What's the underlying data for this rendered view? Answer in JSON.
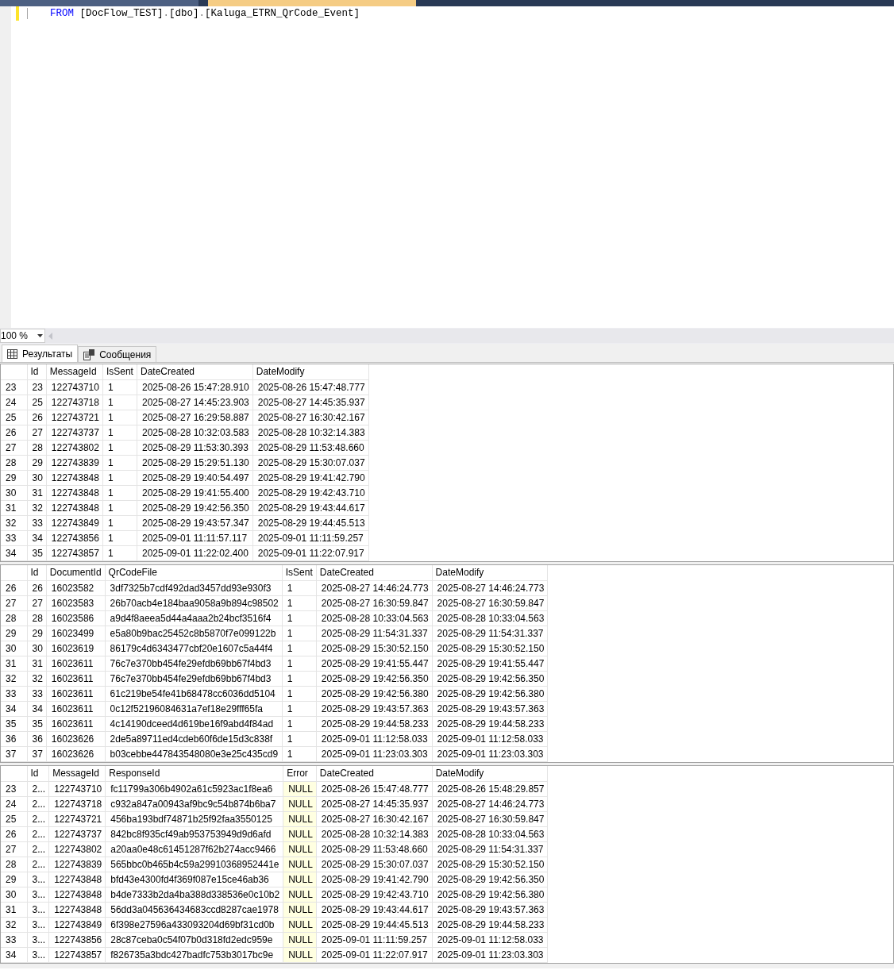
{
  "document_tabs": [
    {
      "selected": false
    },
    {
      "selected": true
    }
  ],
  "editor": {
    "lines": [
      [
        {
          "kind": "keyword",
          "text": "FROM"
        },
        {
          "kind": "plain",
          "text": " [DocFlow_TEST]"
        },
        {
          "kind": "punct",
          "text": "."
        },
        {
          "kind": "plain",
          "text": "[dbo]"
        },
        {
          "kind": "punct",
          "text": "."
        },
        {
          "kind": "plain",
          "text": "[Kaluga_ETRN_QrCode_Event]"
        }
      ]
    ]
  },
  "zoom": {
    "value": "100 %"
  },
  "result_tabs": [
    {
      "label": "Результаты",
      "kind": "grid",
      "selected": true
    },
    {
      "label": "Сообщения",
      "kind": "messages",
      "selected": false
    }
  ],
  "grids": [
    {
      "columns": [
        {
          "label": "Id"
        },
        {
          "label": "MessageId"
        },
        {
          "label": "IsSent"
        },
        {
          "label": "DateCreated"
        },
        {
          "label": "DateModify"
        }
      ],
      "rows": [
        {
          "row_number": "23",
          "cells": [
            "23",
            "122743710",
            "1",
            "2025-08-26 15:47:28.910",
            "2025-08-26 15:47:48.777"
          ]
        },
        {
          "row_number": "24",
          "cells": [
            "25",
            "122743718",
            "1",
            "2025-08-27 14:45:23.903",
            "2025-08-27 14:45:35.937"
          ]
        },
        {
          "row_number": "25",
          "cells": [
            "26",
            "122743721",
            "1",
            "2025-08-27 16:29:58.887",
            "2025-08-27 16:30:42.167"
          ]
        },
        {
          "row_number": "26",
          "cells": [
            "27",
            "122743737",
            "1",
            "2025-08-28 10:32:03.583",
            "2025-08-28 10:32:14.383"
          ]
        },
        {
          "row_number": "27",
          "cells": [
            "28",
            "122743802",
            "1",
            "2025-08-29 11:53:30.393",
            "2025-08-29 11:53:48.660"
          ]
        },
        {
          "row_number": "28",
          "cells": [
            "29",
            "122743839",
            "1",
            "2025-08-29 15:29:51.130",
            "2025-08-29 15:30:07.037"
          ]
        },
        {
          "row_number": "29",
          "cells": [
            "30",
            "122743848",
            "1",
            "2025-08-29 19:40:54.497",
            "2025-08-29 19:41:42.790"
          ]
        },
        {
          "row_number": "30",
          "cells": [
            "31",
            "122743848",
            "1",
            "2025-08-29 19:41:55.400",
            "2025-08-29 19:42:43.710"
          ]
        },
        {
          "row_number": "31",
          "cells": [
            "32",
            "122743848",
            "1",
            "2025-08-29 19:42:56.350",
            "2025-08-29 19:43:44.617"
          ]
        },
        {
          "row_number": "32",
          "cells": [
            "33",
            "122743849",
            "1",
            "2025-08-29 19:43:57.347",
            "2025-08-29 19:44:45.513"
          ]
        },
        {
          "row_number": "33",
          "cells": [
            "34",
            "122743856",
            "1",
            "2025-09-01 11:11:57.117",
            "2025-09-01 11:11:59.257"
          ]
        },
        {
          "row_number": "34",
          "cells": [
            "35",
            "122743857",
            "1",
            "2025-09-01 11:22:02.400",
            "2025-09-01 11:22:07.917"
          ]
        }
      ]
    },
    {
      "columns": [
        {
          "label": "Id"
        },
        {
          "label": "DocumentId"
        },
        {
          "label": "QrCodeFile"
        },
        {
          "label": "IsSent"
        },
        {
          "label": "DateCreated"
        },
        {
          "label": "DateModify"
        }
      ],
      "rows": [
        {
          "row_number": "26",
          "cells": [
            "26",
            "16023582",
            "3df7325b7cdf492dad3457dd93e930f3",
            "1",
            "2025-08-27 14:46:24.773",
            "2025-08-27 14:46:24.773"
          ]
        },
        {
          "row_number": "27",
          "cells": [
            "27",
            "16023583",
            "26b70acb4e184baa9058a9b894c98502",
            "1",
            "2025-08-27 16:30:59.847",
            "2025-08-27 16:30:59.847"
          ]
        },
        {
          "row_number": "28",
          "cells": [
            "28",
            "16023586",
            "a9d4f8aeea5d44a4aaa2b24bcf3516f4",
            "1",
            "2025-08-28 10:33:04.563",
            "2025-08-28 10:33:04.563"
          ]
        },
        {
          "row_number": "29",
          "cells": [
            "29",
            "16023499",
            "e5a80b9bac25452c8b5870f7e099122b",
            "1",
            "2025-08-29 11:54:31.337",
            "2025-08-29 11:54:31.337"
          ]
        },
        {
          "row_number": "30",
          "cells": [
            "30",
            "16023619",
            "86179c4d6343477cbf20e1607c5a44f4",
            "1",
            "2025-08-29 15:30:52.150",
            "2025-08-29 15:30:52.150"
          ]
        },
        {
          "row_number": "31",
          "cells": [
            "31",
            "16023611",
            "76c7e370bb454fe29efdb69bb67f4bd3",
            "1",
            "2025-08-29 19:41:55.447",
            "2025-08-29 19:41:55.447"
          ]
        },
        {
          "row_number": "32",
          "cells": [
            "32",
            "16023611",
            "76c7e370bb454fe29efdb69bb67f4bd3",
            "1",
            "2025-08-29 19:42:56.350",
            "2025-08-29 19:42:56.350"
          ]
        },
        {
          "row_number": "33",
          "cells": [
            "33",
            "16023611",
            "61c219be54fe41b68478cc6036dd5104",
            "1",
            "2025-08-29 19:42:56.380",
            "2025-08-29 19:42:56.380"
          ]
        },
        {
          "row_number": "34",
          "cells": [
            "34",
            "16023611",
            "0c12f52196084631a7ef18e29fff65fa",
            "1",
            "2025-08-29 19:43:57.363",
            "2025-08-29 19:43:57.363"
          ]
        },
        {
          "row_number": "35",
          "cells": [
            "35",
            "16023611",
            "4c14190dceed4d619be16f9abd4f84ad",
            "1",
            "2025-08-29 19:44:58.233",
            "2025-08-29 19:44:58.233"
          ]
        },
        {
          "row_number": "36",
          "cells": [
            "36",
            "16023626",
            "2de5a89711ed4cdeb60f6de15d3c838f",
            "1",
            "2025-09-01 11:12:58.033",
            "2025-09-01 11:12:58.033"
          ]
        },
        {
          "row_number": "37",
          "cells": [
            "37",
            "16023626",
            "b03cebbe447843548080e3e25c435cd9",
            "1",
            "2025-09-01 11:23:03.303",
            "2025-09-01 11:23:03.303"
          ]
        }
      ]
    },
    {
      "columns": [
        {
          "label": "Id"
        },
        {
          "label": "MessageId"
        },
        {
          "label": "ResponseId"
        },
        {
          "label": "Error",
          "null_highlight": true
        },
        {
          "label": "DateCreated"
        },
        {
          "label": "DateModify"
        }
      ],
      "rows": [
        {
          "row_number": "23",
          "cells": [
            "2...",
            "122743710",
            "fc11799a306b4902a61c5923ac1f8ea6",
            "NULL",
            "2025-08-26 15:47:48.777",
            "2025-08-26 15:48:29.857"
          ]
        },
        {
          "row_number": "24",
          "cells": [
            "2...",
            "122743718",
            "c932a847a00943af9bc9c54b874b6ba7",
            "NULL",
            "2025-08-27 14:45:35.937",
            "2025-08-27 14:46:24.773"
          ]
        },
        {
          "row_number": "25",
          "cells": [
            "2...",
            "122743721",
            "456ba193bdf74871b25f92faa3550125",
            "NULL",
            "2025-08-27 16:30:42.167",
            "2025-08-27 16:30:59.847"
          ]
        },
        {
          "row_number": "26",
          "cells": [
            "2...",
            "122743737",
            "842bc8f935cf49ab953753949d9d6afd",
            "NULL",
            "2025-08-28 10:32:14.383",
            "2025-08-28 10:33:04.563"
          ]
        },
        {
          "row_number": "27",
          "cells": [
            "2...",
            "122743802",
            "a20aa0e48c61451287f62b274acc9466",
            "NULL",
            "2025-08-29 11:53:48.660",
            "2025-08-29 11:54:31.337"
          ]
        },
        {
          "row_number": "28",
          "cells": [
            "2...",
            "122743839",
            "565bbc0b465b4c59a29910368952441e",
            "NULL",
            "2025-08-29 15:30:07.037",
            "2025-08-29 15:30:52.150"
          ]
        },
        {
          "row_number": "29",
          "cells": [
            "3...",
            "122743848",
            "bfd43e4300fd4f369f087e15ce46ab36",
            "NULL",
            "2025-08-29 19:41:42.790",
            "2025-08-29 19:42:56.350"
          ]
        },
        {
          "row_number": "30",
          "cells": [
            "3...",
            "122743848",
            "b4de7333b2da4ba388d338536e0c10b2",
            "NULL",
            "2025-08-29 19:42:43.710",
            "2025-08-29 19:42:56.380"
          ]
        },
        {
          "row_number": "31",
          "cells": [
            "3...",
            "122743848",
            "56dd3a045636434683ccd8287cae1978",
            "NULL",
            "2025-08-29 19:43:44.617",
            "2025-08-29 19:43:57.363"
          ]
        },
        {
          "row_number": "32",
          "cells": [
            "3...",
            "122743849",
            "6f398e27596a433093204d69bf31cd0b",
            "NULL",
            "2025-08-29 19:44:45.513",
            "2025-08-29 19:44:58.233"
          ]
        },
        {
          "row_number": "33",
          "cells": [
            "3...",
            "122743856",
            "28c87ceba0c54f07b0d318fd2edc959e",
            "NULL",
            "2025-09-01 11:11:59.257",
            "2025-09-01 11:12:58.033"
          ]
        },
        {
          "row_number": "34",
          "cells": [
            "3...",
            "122743857",
            "f826735a3bdc427badfc753b3017bc9e",
            "NULL",
            "2025-09-01 11:22:07.917",
            "2025-09-01 11:23:03.303"
          ]
        }
      ]
    }
  ]
}
